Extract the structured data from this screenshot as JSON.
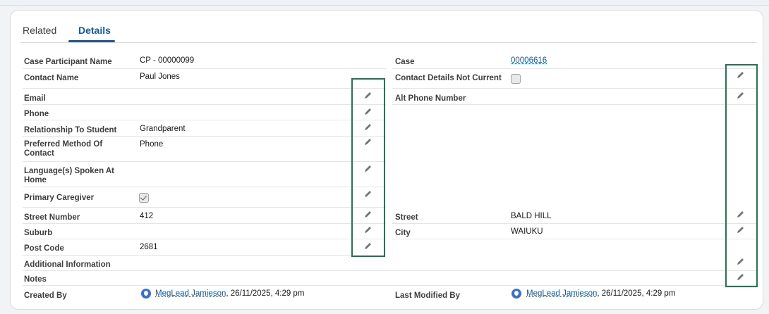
{
  "tabs": [
    "Related",
    "Details"
  ],
  "left_fields": [
    {
      "label": "Case Participant Name",
      "value": "CP - 00000099"
    },
    {
      "label": "Contact Name",
      "value": "Paul Jones"
    },
    {
      "label": "Email",
      "value": ""
    },
    {
      "label": "Phone",
      "value": ""
    },
    {
      "label": "Relationship To Student",
      "value": "Grandparent"
    },
    {
      "label": "Preferred Method Of Contact",
      "value": "Phone"
    },
    {
      "label": "Language(s) Spoken At Home",
      "value": ""
    },
    {
      "label": "Primary Caregiver",
      "value": "checked"
    },
    {
      "label": "Street Number",
      "value": "412"
    },
    {
      "label": "Suburb",
      "value": ""
    },
    {
      "label": "Post Code",
      "value": "2681"
    },
    {
      "label": "Additional Information",
      "value": ""
    },
    {
      "label": "Notes",
      "value": ""
    },
    {
      "label": "Created By",
      "value_user": "MegLead Jamieson",
      "value_date": ", 26/11/2025, 4:29 pm"
    }
  ],
  "right_fields": [
    {
      "label": "Case",
      "value": "00006616"
    },
    {
      "label": "Contact Details Not Current",
      "value": "unchecked"
    },
    {
      "label": "Alt Phone Number",
      "value": ""
    },
    {
      "label": "Street",
      "value": "BALD HILL"
    },
    {
      "label": "City",
      "value": "WAIUKU"
    },
    {
      "label": "Last Modified By",
      "value_user": "MegLead Jamieson",
      "value_date": ", 26/11/2025, 4:29 pm"
    }
  ],
  "colors": {
    "highlight": "#1d7a4e",
    "link": "#0b5cab"
  },
  "icons": {
    "edit": "pencil-icon",
    "user": "user-avatar-icon"
  }
}
